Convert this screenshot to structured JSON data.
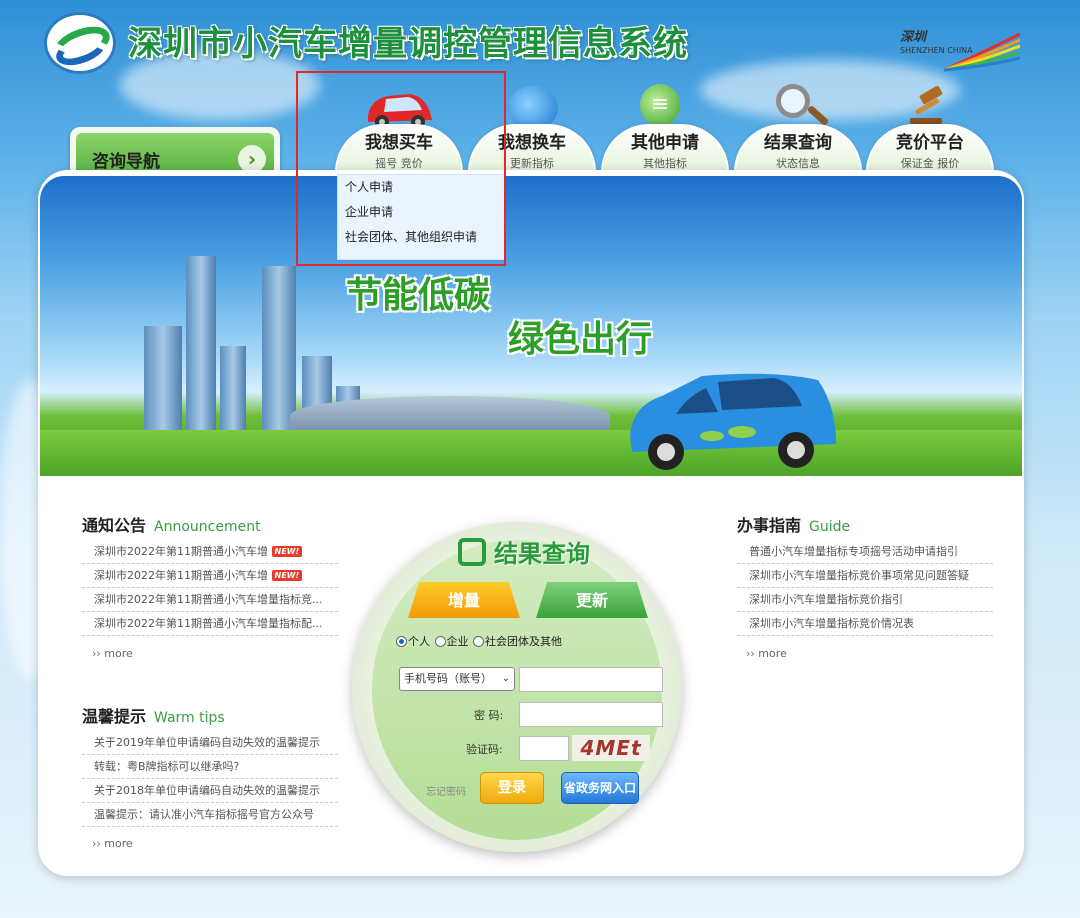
{
  "header": {
    "title": "深圳市小汽车增量调控管理信息系统",
    "city_logo_text": "深圳",
    "city_logo_sub": "SHENZHEN CHINA"
  },
  "consult": {
    "label": "咨询导航"
  },
  "nav": [
    {
      "label": "我想买车",
      "sub": "摇号  竞价",
      "icon": "car-icon"
    },
    {
      "label": "我想换车",
      "sub": "更新指标",
      "icon": "swap-icon"
    },
    {
      "label": "其他申请",
      "sub": "其他指标",
      "icon": "document-icon"
    },
    {
      "label": "结果查询",
      "sub": "状态信息",
      "icon": "magnifier-icon"
    },
    {
      "label": "竞价平台",
      "sub": "保证金  报价",
      "icon": "gavel-icon"
    }
  ],
  "dropdown": [
    "个人申请",
    "企业申请",
    "社会团体、其他组织申请"
  ],
  "banner": {
    "line1": "节能低碳",
    "line2": "绿色出行"
  },
  "announcement": {
    "title": "通知公告",
    "title_en": "Announcement",
    "items": [
      {
        "text": "深圳市2022年第11期普通小汽车增",
        "new": "NEW!"
      },
      {
        "text": "深圳市2022年第11期普通小汽车增",
        "new": "NEW!"
      },
      {
        "text": "深圳市2022年第11期普通小汽车增量指标竞..."
      },
      {
        "text": "深圳市2022年第11期普通小汽车增量指标配..."
      }
    ],
    "more": "more"
  },
  "tips": {
    "title": "温馨提示",
    "title_en": "Warm tips",
    "items": [
      "关于2019年单位申请编码自动失效的温馨提示",
      "转载：粤B牌指标可以继承吗?",
      "关于2018年单位申请编码自动失效的温馨提示",
      "温馨提示：请认准小汽车指标摇号官方公众号"
    ],
    "more": "more"
  },
  "guide": {
    "title": "办事指南",
    "title_en": "Guide",
    "items": [
      "普通小汽车增量指标专项摇号活动申请指引",
      "深圳市小汽车增量指标竞价事项常见问题答疑",
      "深圳市小汽车增量指标竞价指引",
      "深圳市小汽车增量指标竞价情况表"
    ],
    "more": "more"
  },
  "query": {
    "title": "结果查询",
    "tab_increase": "增量",
    "tab_update": "更新",
    "radios": [
      "个人",
      "企业",
      "社会团体及其他"
    ],
    "account_select": "手机号码（账号）",
    "password_label": "密  码:",
    "captcha_label": "验证码:",
    "captcha_text": "4MEt",
    "forgot": "忘记密码",
    "login": "登录",
    "gov_login": "省政务网入口"
  }
}
